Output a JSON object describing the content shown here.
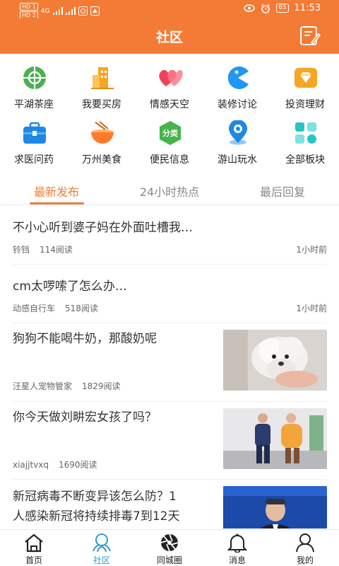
{
  "status_bar": {
    "sim1": "HD 1",
    "sim2": "HD 2",
    "net": "4G",
    "battery": "65",
    "time": "11:53"
  },
  "header": {
    "title": "社区"
  },
  "categories": [
    {
      "label": "平湖茶座",
      "icon": "teahouse-icon",
      "color": "#4caf50"
    },
    {
      "label": "我要买房",
      "icon": "building-icon",
      "color": "#f5a623"
    },
    {
      "label": "情感天空",
      "icon": "hearts-icon",
      "color": "#f0435a"
    },
    {
      "label": "装修讨论",
      "icon": "pacman-icon",
      "color": "#2196f3"
    },
    {
      "label": "投资理财",
      "icon": "gem-icon",
      "color": "#f5a623"
    },
    {
      "label": "求医问药",
      "icon": "medkit-icon",
      "color": "#1e88e5"
    },
    {
      "label": "万州美食",
      "icon": "noodle-bowl-icon",
      "color": "#ff7a2a"
    },
    {
      "label": "便民信息",
      "icon": "classified-icon",
      "color": "#43b54a"
    },
    {
      "label": "游山玩水",
      "icon": "location-pin-icon",
      "color": "#1e88e5"
    },
    {
      "label": "全部板块",
      "icon": "all-boards-icon",
      "color": "#26c6c6"
    }
  ],
  "tabs": [
    "最新发布",
    "24小时热点",
    "最后回复"
  ],
  "posts": [
    {
      "title": "不小心听到婆子妈在外面吐槽我…",
      "author": "铃铛",
      "views": "114阅读",
      "time": "1小时前"
    },
    {
      "title": "cm太啰嗦了怎么办…",
      "author": "动感自行车",
      "views": "518阅读",
      "time": "1小时前"
    },
    {
      "title": "狗狗不能喝牛奶，那酸奶呢",
      "author": "汪星人宠物管家",
      "views": "1829阅读"
    },
    {
      "title": "你今天做刘畊宏女孩了吗？",
      "author": "xiajjtvxq",
      "views": "1690阅读"
    },
    {
      "title_line1": "新冠病毒不断变异该怎么防？1",
      "title_line2": "人感染新冠将持续排毒7到12天"
    }
  ],
  "bottom_nav": [
    {
      "label": "首页",
      "icon": "home-icon"
    },
    {
      "label": "社区",
      "icon": "community-icon"
    },
    {
      "label": "同城圈",
      "icon": "aperture-icon"
    },
    {
      "label": "消息",
      "icon": "bell-icon"
    },
    {
      "label": "我的",
      "icon": "profile-icon"
    }
  ]
}
